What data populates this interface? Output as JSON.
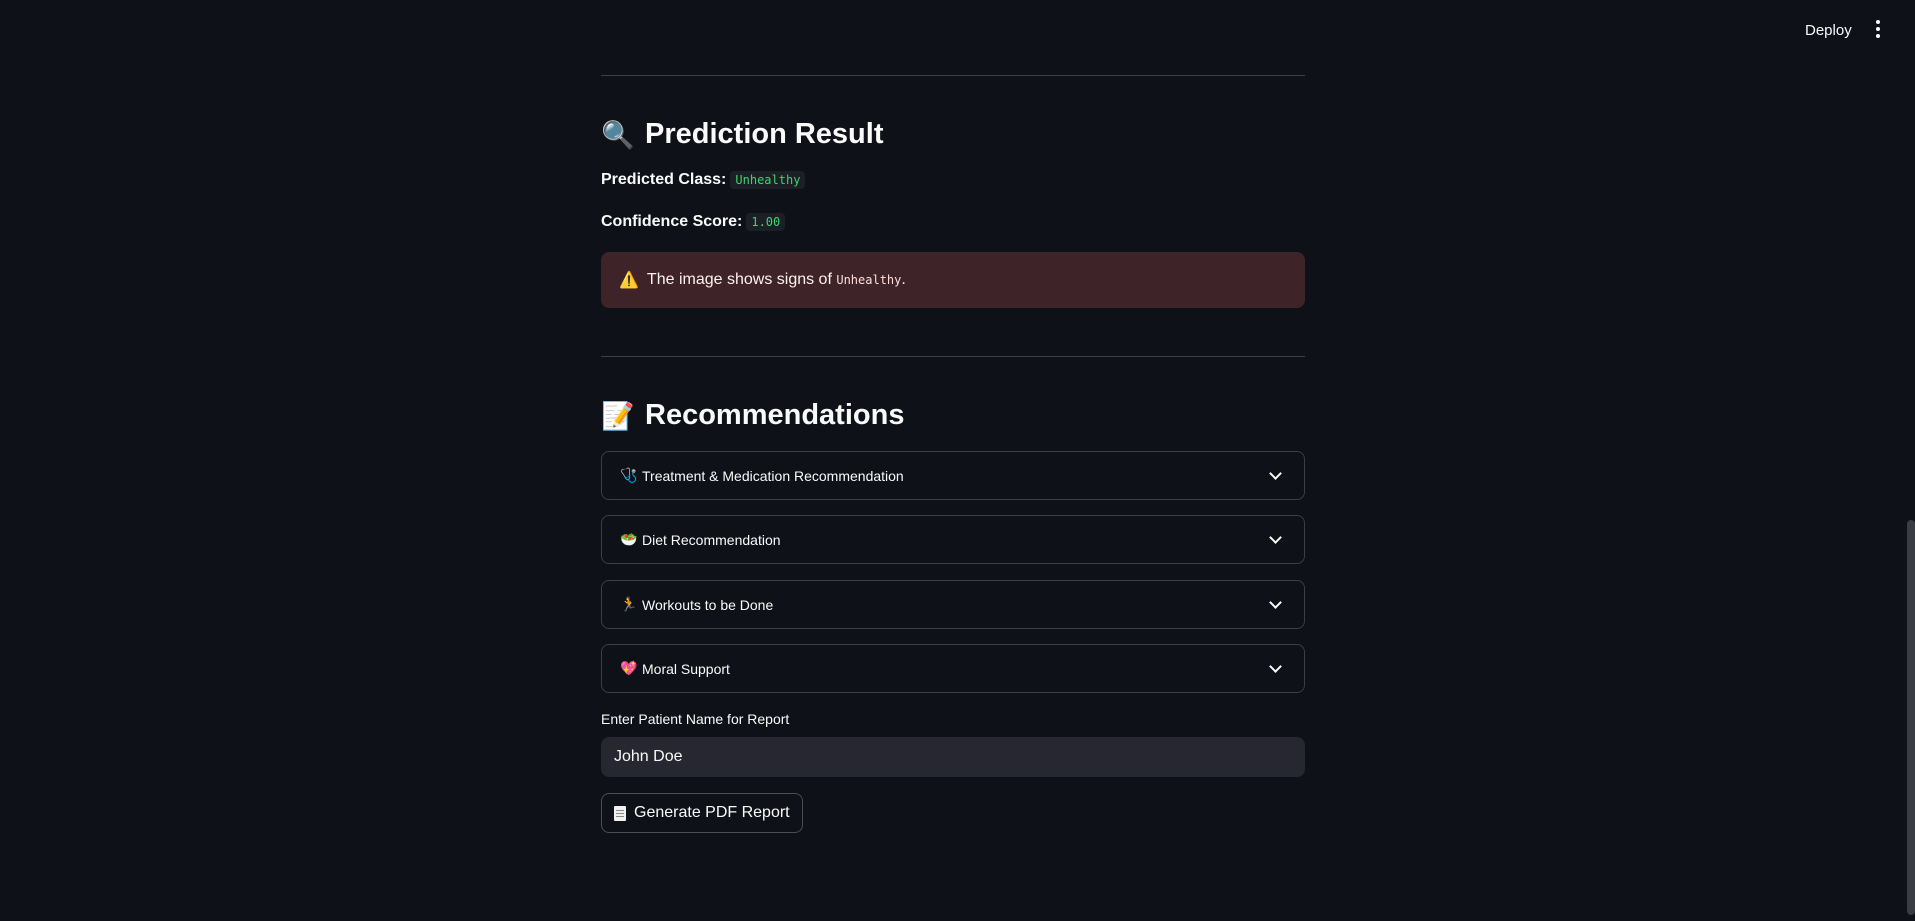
{
  "header": {
    "deploy_label": "Deploy"
  },
  "prediction": {
    "title_icon": "🔍",
    "title": "Prediction Result",
    "class_label": "Predicted Class:",
    "class_value": "Unhealthy",
    "confidence_label": "Confidence Score:",
    "confidence_value": "1.00",
    "alert_icon": "⚠️",
    "alert_text": "The image shows signs of",
    "alert_value": "Unhealthy",
    "alert_suffix": "."
  },
  "recommendations": {
    "title_icon": "📝",
    "title": "Recommendations",
    "items": [
      {
        "icon": "🩺",
        "label": "Treatment & Medication Recommendation"
      },
      {
        "icon": "🥗",
        "label": "Diet Recommendation"
      },
      {
        "icon": "🏃",
        "label": "Workouts to be Done"
      },
      {
        "icon": "💖",
        "label": "Moral Support"
      }
    ]
  },
  "report": {
    "input_label": "Enter Patient Name for Report",
    "input_value": "John Doe",
    "button_icon": "document-icon",
    "button_label": "Generate PDF Report"
  },
  "colors": {
    "background": "#0e1117",
    "code_text": "#3dd56d",
    "alert_bg": "#3e2428"
  }
}
